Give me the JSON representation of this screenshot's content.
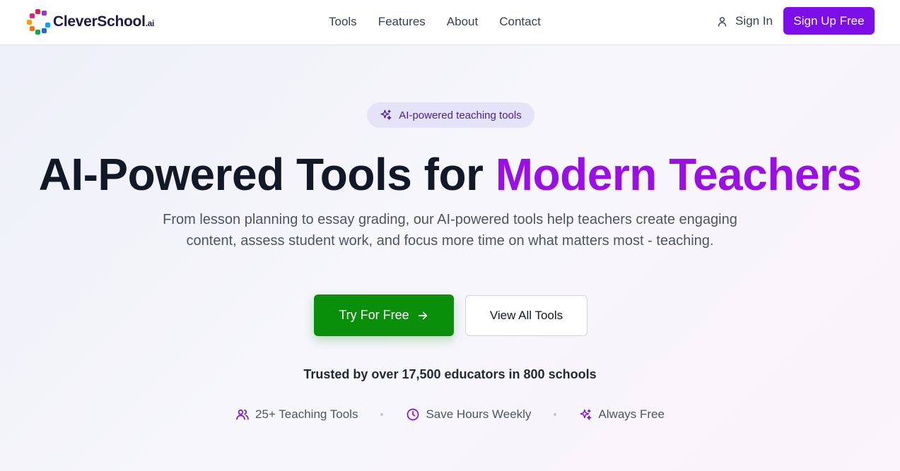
{
  "header": {
    "logo_name": "CleverSchool",
    "logo_suffix": ".ai",
    "nav": [
      "Tools",
      "Features",
      "About",
      "Contact"
    ],
    "sign_in": "Sign In",
    "sign_up": "Sign Up Free"
  },
  "hero": {
    "badge": "AI-powered teaching tools",
    "title_main": "AI-Powered Tools for ",
    "title_accent": "Modern Teachers",
    "subtitle": "From lesson planning to essay grading, our AI-powered tools help teachers create engaging content, assess student work, and focus more time on what matters most - teaching.",
    "primary_cta": "Try For Free",
    "secondary_cta": "View All Tools",
    "trusted": "Trusted by over 17,500 educators in 800 schools",
    "features": [
      {
        "icon": "users-icon",
        "label": "25+ Teaching Tools"
      },
      {
        "icon": "clock-icon",
        "label": "Save Hours Weekly"
      },
      {
        "icon": "sparkle-icon",
        "label": "Always Free"
      }
    ]
  },
  "colors": {
    "brand_purple": "#7c0ee8",
    "accent_purple": "#9b0ee6",
    "cta_green": "#0a8f0a"
  }
}
